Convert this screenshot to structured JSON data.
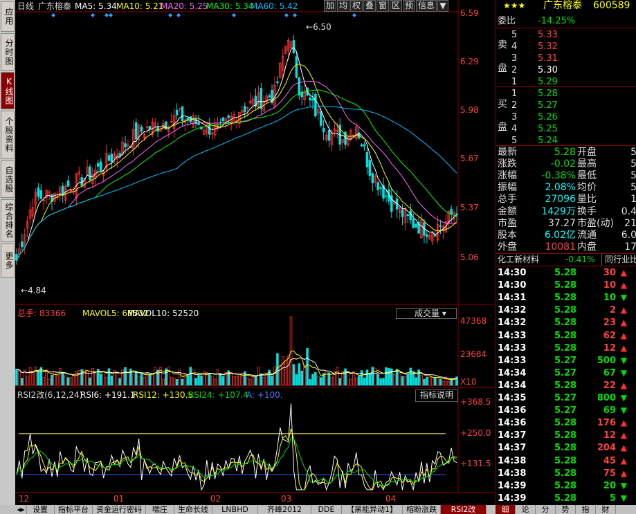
{
  "left_nav": [
    {
      "label": "应用"
    },
    {
      "label": "分时图"
    },
    {
      "label": "K线图",
      "active": true
    },
    {
      "label": "个股资料"
    },
    {
      "label": "自选股"
    },
    {
      "label": "综合排名"
    },
    {
      "label": "更多"
    }
  ],
  "header": {
    "period": "日线",
    "name": "广东榕泰",
    "ma5": "MA5: 5.34",
    "ma10": "MA10: 5.21",
    "ma20": "MA20: 5.25",
    "ma30": "MA30: 5.34",
    "ma60": "MA60: 5.42",
    "toolbar": [
      "加",
      "均",
      "权",
      "叠",
      "窗",
      "区",
      "预",
      "信息",
      "▼"
    ]
  },
  "price_axis": [
    "6.59",
    "6.29",
    "5.98",
    "5.67",
    "5.37",
    "5.06"
  ],
  "annotations": {
    "high": "6.50",
    "low": "4.84"
  },
  "volume": {
    "label": "总手: 83366",
    "mavol5": "MAVOL5: 68532",
    "mavol10": "MAVOL10: 52520",
    "dropdown": "成交量",
    "axis": [
      "47368",
      "23684",
      "X10"
    ]
  },
  "rsi": {
    "label": "RSI2改(6,12,24)",
    "rsi6": "RSI6: +191.1",
    "rsi12": "RSI12: +130.5",
    "rsi24": "RSI24: +107.4",
    "a": "A: +100.",
    "button": "指标说明",
    "axis": [
      "+368.5",
      "+250.0",
      "+131.5"
    ]
  },
  "date_axis": [
    "12",
    "01",
    "02",
    "03",
    "04"
  ],
  "bottom_tabs": [
    "设置",
    "指标平台",
    "资金运行密码",
    "喘庄",
    "生命长线",
    "LNBHD",
    "齐峰2012",
    "DDE",
    "【黑能异动1】",
    "榕盼涨跌",
    "RSI2改"
  ],
  "bottom_tabs_active": "RSI2改",
  "right_tabs": [
    "细",
    "论",
    "分",
    "势",
    "指",
    "财"
  ],
  "quote": {
    "stars": "★★★",
    "title": "广东榕泰",
    "code": "600589",
    "wb_label": "委比",
    "wb_value": "-14.25%",
    "sell_label": [
      "卖",
      "盘"
    ],
    "sells": [
      {
        "n": "5",
        "p": "5.33"
      },
      {
        "n": "4",
        "p": "5.32"
      },
      {
        "n": "3",
        "p": "5.31"
      },
      {
        "n": "2",
        "p": "5.30"
      },
      {
        "n": "1",
        "p": "5.29"
      }
    ],
    "buy_label": [
      "买",
      "盘"
    ],
    "buys": [
      {
        "n": "1",
        "p": "5.28"
      },
      {
        "n": "2",
        "p": "5.27"
      },
      {
        "n": "3",
        "p": "5.26"
      },
      {
        "n": "4",
        "p": "5.25"
      },
      {
        "n": "5",
        "p": "5.24"
      }
    ],
    "stats": [
      {
        "l": "最新",
        "v": "5.28",
        "l2": "开盘",
        "v2": "5"
      },
      {
        "l": "涨跌",
        "v": "-0.02",
        "l2": "最高",
        "v2": "5"
      },
      {
        "l": "涨幅",
        "v": "-0.38%",
        "l2": "最低",
        "v2": "5"
      },
      {
        "l": "振幅",
        "v": "2.08%",
        "l2": "均价",
        "v2": "5"
      },
      {
        "l": "总手",
        "v": "27096",
        "l2": "量比",
        "v2": "1"
      },
      {
        "l": "金额",
        "v": "1429万",
        "l2": "换手",
        "v2": "0.4"
      },
      {
        "l": "市盈",
        "v": "37.27",
        "l2": "市盈(动)",
        "v2": "21"
      },
      {
        "l": "股本",
        "v": "6.02亿",
        "l2": "流通",
        "v2": "6.0"
      },
      {
        "l": "外盘",
        "v": "10081",
        "l2": "内盘",
        "v2": "17"
      }
    ],
    "sector": "化工新材料",
    "sector_chg": "-0.41%",
    "sector_btn": "同行业比",
    "ticks": [
      {
        "t": "14:30",
        "p": "5.28",
        "v": "30",
        "d": "up"
      },
      {
        "t": "14:30",
        "p": "5.28",
        "v": "10",
        "d": "up"
      },
      {
        "t": "14:31",
        "p": "5.28",
        "v": "10",
        "d": "down"
      },
      {
        "t": "14:32",
        "p": "5.28",
        "v": "2",
        "d": "up"
      },
      {
        "t": "14:32",
        "p": "5.28",
        "v": "23",
        "d": "up"
      },
      {
        "t": "14:33",
        "p": "5.28",
        "v": "62",
        "d": "up"
      },
      {
        "t": "14:33",
        "p": "5.28",
        "v": "12",
        "d": "up"
      },
      {
        "t": "14:33",
        "p": "5.27",
        "v": "500",
        "d": "down"
      },
      {
        "t": "14:34",
        "p": "5.27",
        "v": "67",
        "d": "down"
      },
      {
        "t": "14:34",
        "p": "5.28",
        "v": "22",
        "d": "up"
      },
      {
        "t": "14:35",
        "p": "5.27",
        "v": "800",
        "d": "down"
      },
      {
        "t": "14:36",
        "p": "5.27",
        "v": "69",
        "d": "down"
      },
      {
        "t": "14:36",
        "p": "5.28",
        "v": "176",
        "d": "up"
      },
      {
        "t": "14:37",
        "p": "5.28",
        "v": "12",
        "d": "up"
      },
      {
        "t": "14:37",
        "p": "5.28",
        "v": "204",
        "d": "up"
      },
      {
        "t": "14:38",
        "p": "5.28",
        "v": "45",
        "d": "up"
      },
      {
        "t": "14:38",
        "p": "5.28",
        "v": "75",
        "d": "up"
      },
      {
        "t": "14:39",
        "p": "5.28",
        "v": "20",
        "d": "down"
      },
      {
        "t": "14:39",
        "p": "5.28",
        "v": "5",
        "d": "down"
      }
    ]
  },
  "colors": {
    "up": "#ff3030",
    "down": "#00e0e0",
    "ma5": "#ffffff",
    "ma10": "#ffff00",
    "ma20": "#ff66ff",
    "ma30": "#00ff00",
    "ma60": "#00c0ff"
  }
}
